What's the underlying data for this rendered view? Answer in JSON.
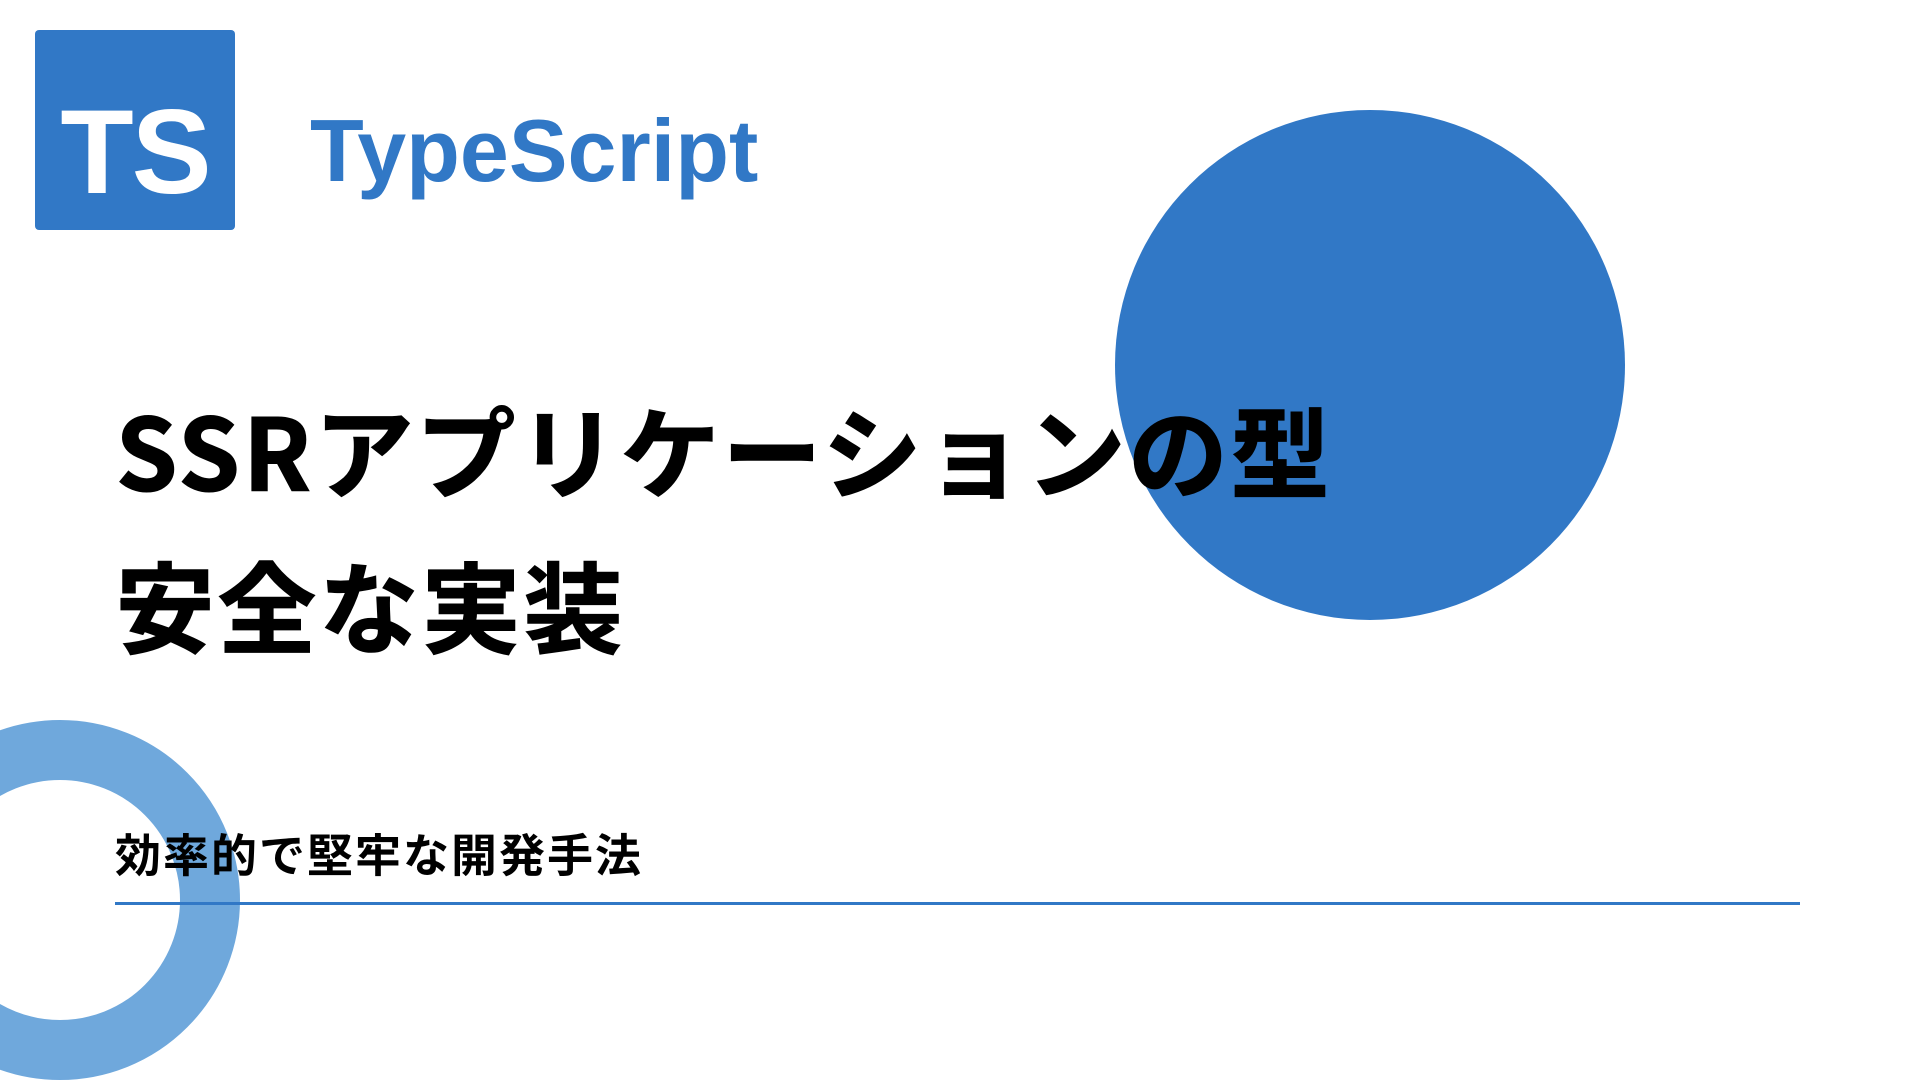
{
  "logo": {
    "text": "TS"
  },
  "brand": "TypeScript",
  "title_line1": "SSRアプリケーションの型",
  "title_line2": "安全な実装",
  "subtitle": "効率的で堅牢な開発手法",
  "colors": {
    "accent": "#3178c6",
    "ring": "#6fa8dc"
  }
}
